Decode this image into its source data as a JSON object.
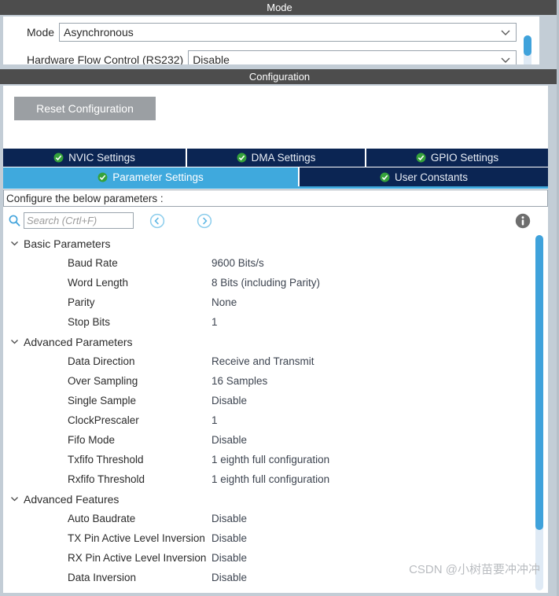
{
  "mode_panel": {
    "header_title": "Mode",
    "rows": [
      {
        "label": "Mode",
        "value": "Asynchronous",
        "icon": "chevron-down-icon"
      },
      {
        "label": "Hardware Flow Control (RS232)",
        "value": "Disable",
        "icon": "chevron-down-icon"
      }
    ]
  },
  "config_panel": {
    "header_title": "Configuration",
    "reset_button_label": "Reset Configuration",
    "tabs_row_1": [
      {
        "label": "NVIC Settings",
        "icon": "check-circle-icon",
        "active": false
      },
      {
        "label": "DMA Settings",
        "icon": "check-circle-icon",
        "active": false
      },
      {
        "label": "GPIO Settings",
        "icon": "check-circle-icon",
        "active": false
      }
    ],
    "tabs_row_2": [
      {
        "label": "Parameter Settings",
        "icon": "check-circle-icon",
        "active": true
      },
      {
        "label": "User Constants",
        "icon": "check-circle-icon",
        "active": false
      }
    ],
    "configure_banner": "Configure the below parameters :",
    "search": {
      "placeholder": "Search (Crtl+F)",
      "value": "",
      "icon": "search-icon",
      "back_icon": "circle-left-arrow-icon",
      "forward_icon": "circle-right-arrow-icon",
      "info_icon": "info-icon"
    },
    "parameter_groups": [
      {
        "title": "Basic Parameters",
        "expanded": true,
        "parameters": [
          {
            "name": "Baud Rate",
            "value": "9600 Bits/s"
          },
          {
            "name": "Word Length",
            "value": "8 Bits (including Parity)"
          },
          {
            "name": "Parity",
            "value": "None"
          },
          {
            "name": "Stop Bits",
            "value": "1"
          }
        ]
      },
      {
        "title": "Advanced Parameters",
        "expanded": true,
        "parameters": [
          {
            "name": "Data Direction",
            "value": "Receive and Transmit"
          },
          {
            "name": "Over Sampling",
            "value": "16 Samples"
          },
          {
            "name": "Single Sample",
            "value": "Disable"
          },
          {
            "name": "ClockPrescaler",
            "value": "1"
          },
          {
            "name": "Fifo Mode",
            "value": "Disable"
          },
          {
            "name": "Txfifo Threshold",
            "value": "1 eighth full configuration"
          },
          {
            "name": "Rxfifo Threshold",
            "value": "1 eighth full configuration"
          }
        ]
      },
      {
        "title": "Advanced Features",
        "expanded": true,
        "parameters": [
          {
            "name": "Auto Baudrate",
            "value": "Disable"
          },
          {
            "name": "TX Pin Active Level Inversion",
            "value": "Disable"
          },
          {
            "name": "RX Pin Active Level Inversion",
            "value": "Disable"
          },
          {
            "name": "Data Inversion",
            "value": "Disable"
          }
        ]
      }
    ]
  },
  "watermark": "CSDN @小树苗要冲冲冲",
  "colors": {
    "panel_header_bg": "#4d4d4d",
    "tab_inactive_bg": "#0b2553",
    "tab_active_bg": "#3fa9dd",
    "scrollbar_thumb": "#3fa2db",
    "scrollbar_track": "#dfeaf5",
    "button_bg": "#9b9fa3",
    "check_green": "#35a23b",
    "window_bg": "#c3cdd6"
  }
}
